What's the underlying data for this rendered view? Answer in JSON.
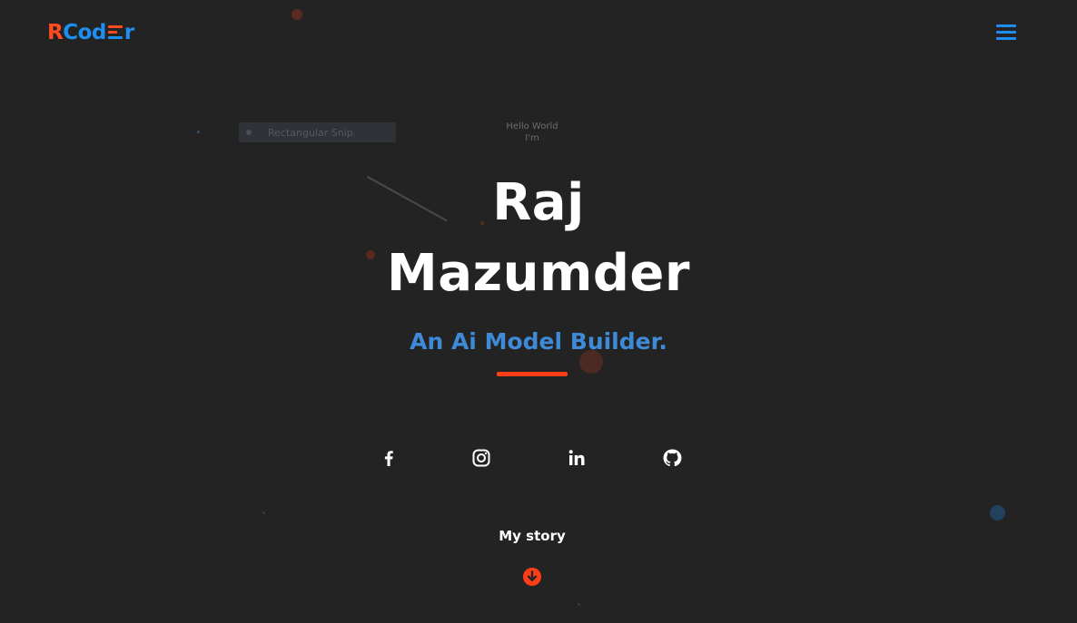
{
  "header": {
    "logo": {
      "r": "R",
      "cod": "Cod",
      "tail": "r"
    },
    "menu_icon": "hamburger-icon"
  },
  "overlay": {
    "snip_label": "Rectangular Snip"
  },
  "hero": {
    "greeting_line1": "Hello World",
    "greeting_line2": "I'm",
    "name_first": "Raj",
    "name_last": "Mazumder",
    "tagline": "An Ai Model Builder."
  },
  "social": [
    {
      "icon": "facebook-icon"
    },
    {
      "icon": "instagram-icon"
    },
    {
      "icon": "linkedin-icon"
    },
    {
      "icon": "github-icon"
    }
  ],
  "story": {
    "label": "My story",
    "icon": "arrow-down-circle-icon"
  },
  "colors": {
    "background": "#232323",
    "accent_orange": "#ff3d17",
    "accent_blue": "#1e8ef0",
    "tagline_blue": "#3f8ad6"
  }
}
